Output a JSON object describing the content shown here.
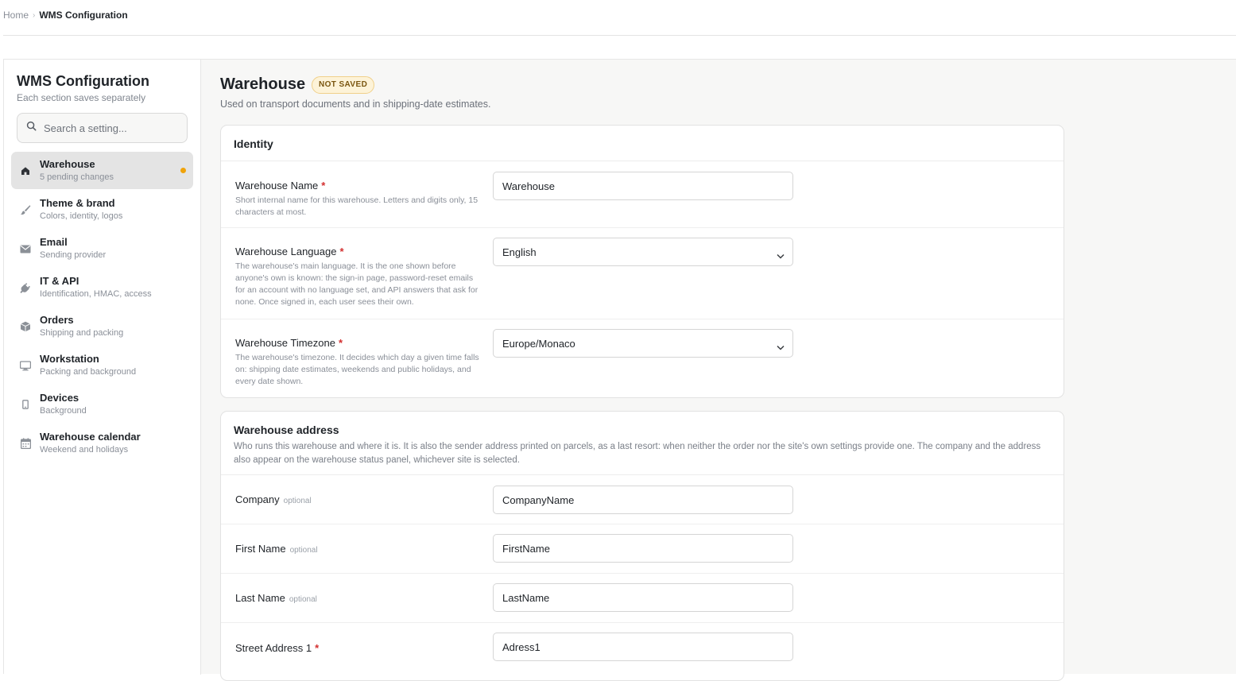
{
  "breadcrumb": {
    "home": "Home",
    "separator": "›",
    "current": "WMS Configuration"
  },
  "sidebar": {
    "title": "WMS Configuration",
    "subtitle": "Each section saves separately",
    "search_placeholder": "Search a setting...",
    "items": [
      {
        "label": "Warehouse",
        "desc": "5 pending changes",
        "icon": "home-icon",
        "active": true,
        "pending": true
      },
      {
        "label": "Theme & brand",
        "desc": "Colors, identity, logos",
        "icon": "brush-icon"
      },
      {
        "label": "Email",
        "desc": "Sending provider",
        "icon": "mail-icon"
      },
      {
        "label": "IT & API",
        "desc": "Identification, HMAC, access",
        "icon": "plug-icon"
      },
      {
        "label": "Orders",
        "desc": "Shipping and packing",
        "icon": "box-icon"
      },
      {
        "label": "Workstation",
        "desc": "Packing and background",
        "icon": "monitor-icon"
      },
      {
        "label": "Devices",
        "desc": "Background",
        "icon": "phone-icon"
      },
      {
        "label": "Warehouse calendar",
        "desc": "Weekend and holidays",
        "icon": "calendar-icon"
      }
    ],
    "accent_color": "#f0a30a"
  },
  "main": {
    "title": "Warehouse",
    "badge": "NOT SAVED",
    "description": "Used on transport documents and in shipping-date estimates.",
    "identity": {
      "title": "Identity",
      "fields": [
        {
          "label": "Warehouse Name",
          "required": "*",
          "help": "Short internal name for this warehouse. Letters and digits only, 15 characters at most.",
          "value": "Warehouse"
        },
        {
          "label": "Warehouse Language",
          "required": "*",
          "help": "The warehouse's main language. It is the one shown before anyone's own is known: the sign-in page, password-reset emails for an account with no language set, and API answers that ask for none. Once signed in, each user sees their own.",
          "value": "English"
        },
        {
          "label": "Warehouse Timezone",
          "required": "*",
          "help": "The warehouse's timezone. It decides which day a given time falls on: shipping date estimates, weekends and public holidays, and every date shown.",
          "value": "Europe/Monaco"
        }
      ]
    },
    "address": {
      "title": "Warehouse address",
      "description": "Who runs this warehouse and where it is. It is also the sender address printed on parcels, as a last resort: when neither the order nor the site's own settings provide one. The company and the address also appear on the warehouse status panel, whichever site is selected.",
      "fields": [
        {
          "label": "Company",
          "optional": "optional",
          "value": "CompanyName"
        },
        {
          "label": "First Name",
          "optional": "optional",
          "value": "FirstName"
        },
        {
          "label": "Last Name",
          "optional": "optional",
          "value": "LastName"
        },
        {
          "label": "Street Address 1",
          "required": "*",
          "value": "Adress1"
        }
      ]
    }
  }
}
